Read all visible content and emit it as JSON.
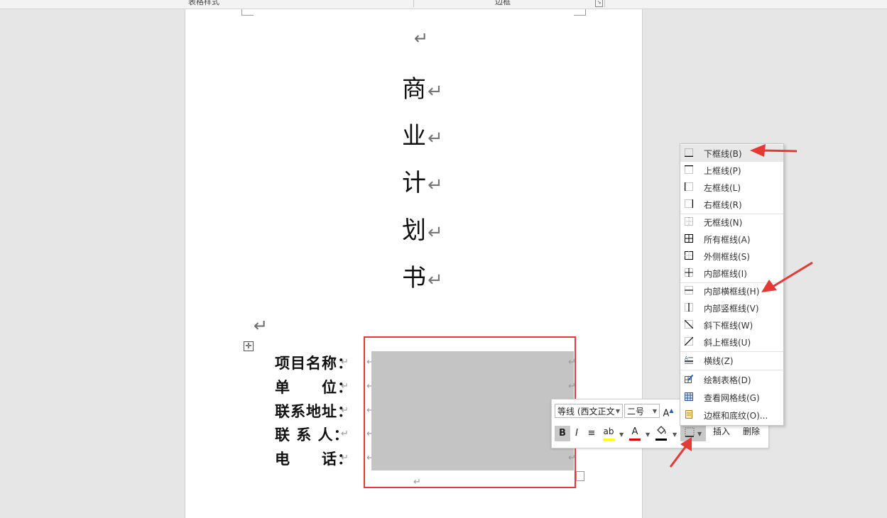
{
  "ribbon": {
    "group_table_styles": "表格样式",
    "group_borders": "边框"
  },
  "document": {
    "title_chars": [
      "商",
      "业",
      "计",
      "划",
      "书"
    ],
    "paragraph_mark": "↵",
    "form": {
      "labels": [
        "项目名称：",
        "单　　位：",
        "联系地址：",
        "联 系 人：",
        "电　　话："
      ],
      "cell_mark": "↵"
    }
  },
  "mini_toolbar": {
    "font_name": "等线 (西文正文",
    "font_size": "二号",
    "grow_font_label": "A",
    "bold_label": "B",
    "italic_label": "I",
    "align_label": "≡",
    "highlight_label": "ab",
    "font_color_label": "A",
    "insert_label": "插入",
    "delete_label": "删除",
    "colors": {
      "highlight": "#ffff00",
      "font_color": "#e00000",
      "shading": "#000000"
    }
  },
  "border_menu": {
    "items": [
      {
        "label": "下框线(B)",
        "icon": "bottom-border-icon"
      },
      {
        "label": "上框线(P)",
        "icon": "top-border-icon"
      },
      {
        "label": "左框线(L)",
        "icon": "left-border-icon"
      },
      {
        "label": "右框线(R)",
        "icon": "right-border-icon"
      },
      {
        "label": "无框线(N)",
        "icon": "no-border-icon"
      },
      {
        "label": "所有框线(A)",
        "icon": "all-borders-icon"
      },
      {
        "label": "外侧框线(S)",
        "icon": "outside-borders-icon"
      },
      {
        "label": "内部框线(I)",
        "icon": "inside-borders-icon"
      },
      {
        "label": "内部横框线(H)",
        "icon": "inside-horizontal-border-icon"
      },
      {
        "label": "内部竖框线(V)",
        "icon": "inside-vertical-border-icon"
      },
      {
        "label": "斜下框线(W)",
        "icon": "diagonal-down-border-icon"
      },
      {
        "label": "斜上框线(U)",
        "icon": "diagonal-up-border-icon"
      },
      {
        "label": "横线(Z)",
        "icon": "horizontal-line-icon"
      },
      {
        "label": "绘制表格(D)",
        "icon": "draw-table-icon"
      },
      {
        "label": "查看网格线(G)",
        "icon": "view-gridlines-icon"
      },
      {
        "label": "边框和底纹(O)...",
        "icon": "borders-shading-icon"
      }
    ]
  },
  "annotation_color": "#e53935"
}
